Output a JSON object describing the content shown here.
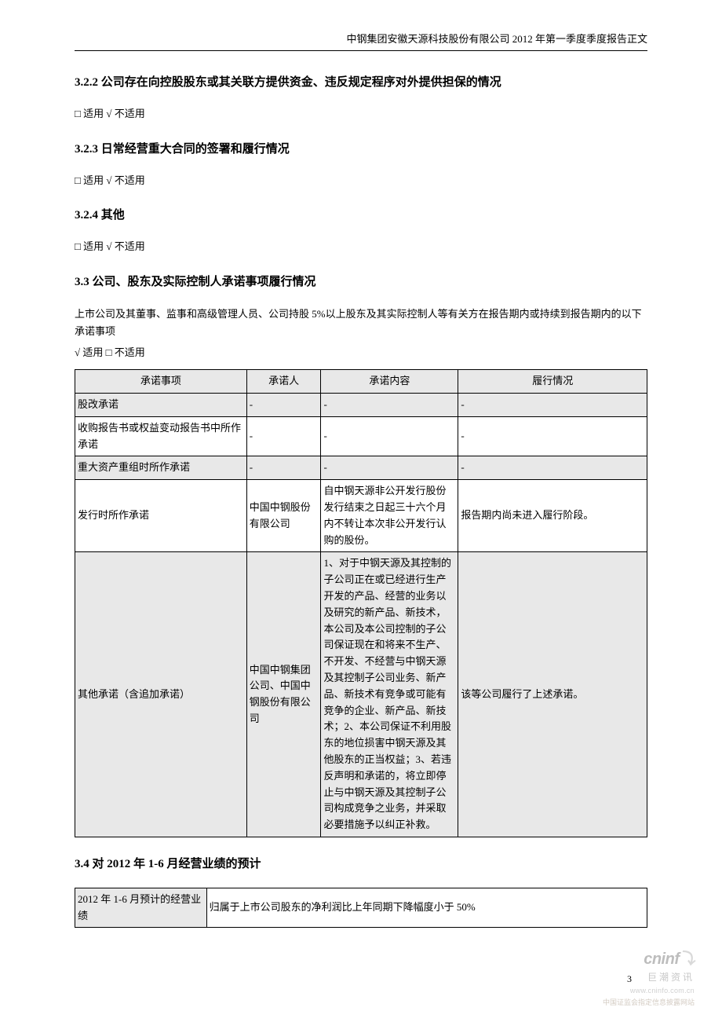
{
  "header": {
    "title": "中钢集团安徽天源科技股份有限公司 2012 年第一季度季度报告正文"
  },
  "page_number": "3",
  "sections": {
    "s322": {
      "heading": "3.2.2 公司存在向控股股东或其关联方提供资金、违反规定程序对外提供担保的情况",
      "applicability": "□ 适用  √ 不适用"
    },
    "s323": {
      "heading": "3.2.3 日常经营重大合同的签署和履行情况",
      "applicability": "□ 适用  √ 不适用"
    },
    "s324": {
      "heading": "3.2.4 其他",
      "applicability": "□ 适用  √ 不适用"
    },
    "s33": {
      "heading": "3.3 公司、股东及实际控制人承诺事项履行情况",
      "intro": "上市公司及其董事、监事和高级管理人员、公司持股 5%以上股东及其实际控制人等有关方在报告期内或持续到报告期内的以下承诺事项",
      "applicability": "√ 适用  □ 不适用",
      "table": {
        "headers": [
          "承诺事项",
          "承诺人",
          "承诺内容",
          "履行情况"
        ],
        "rows": [
          {
            "item": "股改承诺",
            "person": "-",
            "content": "-",
            "perform": "-",
            "striped": true
          },
          {
            "item": "收购报告书或权益变动报告书中所作承诺",
            "person": "-",
            "content": "-",
            "perform": "-",
            "striped": false
          },
          {
            "item": "重大资产重组时所作承诺",
            "person": "-",
            "content": "-",
            "perform": "-",
            "striped": true
          },
          {
            "item": "发行时所作承诺",
            "person": "中国中钢股份有限公司",
            "content": "自中钢天源非公开发行股份发行结束之日起三十六个月内不转让本次非公开发行认购的股份。",
            "perform": "报告期内尚未进入履行阶段。",
            "striped": false
          },
          {
            "item": "其他承诺（含追加承诺）",
            "person": "中国中钢集团公司、中国中钢股份有限公司",
            "content": "1、对于中钢天源及其控制的子公司正在或已经进行生产开发的产品、经营的业务以及研究的新产品、新技术，本公司及本公司控制的子公司保证现在和将来不生产、不开发、不经营与中钢天源及其控制子公司业务、新产品、新技术有竞争或可能有竞争的企业、新产品、新技术；2、本公司保证不利用股东的地位损害中钢天源及其他股东的正当权益；3、若违反声明和承诺的，将立即停止与中钢天源及其控制子公司构成竞争之业务，并采取必要措施予以纠正补救。",
            "perform": "该等公司履行了上述承诺。",
            "striped": true
          }
        ]
      }
    },
    "s34": {
      "heading": "3.4 对 2012 年 1-6 月经营业绩的预计",
      "table": {
        "label": "2012 年 1-6 月预计的经营业绩",
        "value": "归属于上市公司股东的净利润比上年同期下降幅度小于 50%"
      }
    }
  },
  "watermark": {
    "logo": "cninf",
    "logo_zh": "巨潮资讯",
    "url": "www.cninfo.com.cn",
    "sub": "中国证监会指定信息披露网站"
  }
}
